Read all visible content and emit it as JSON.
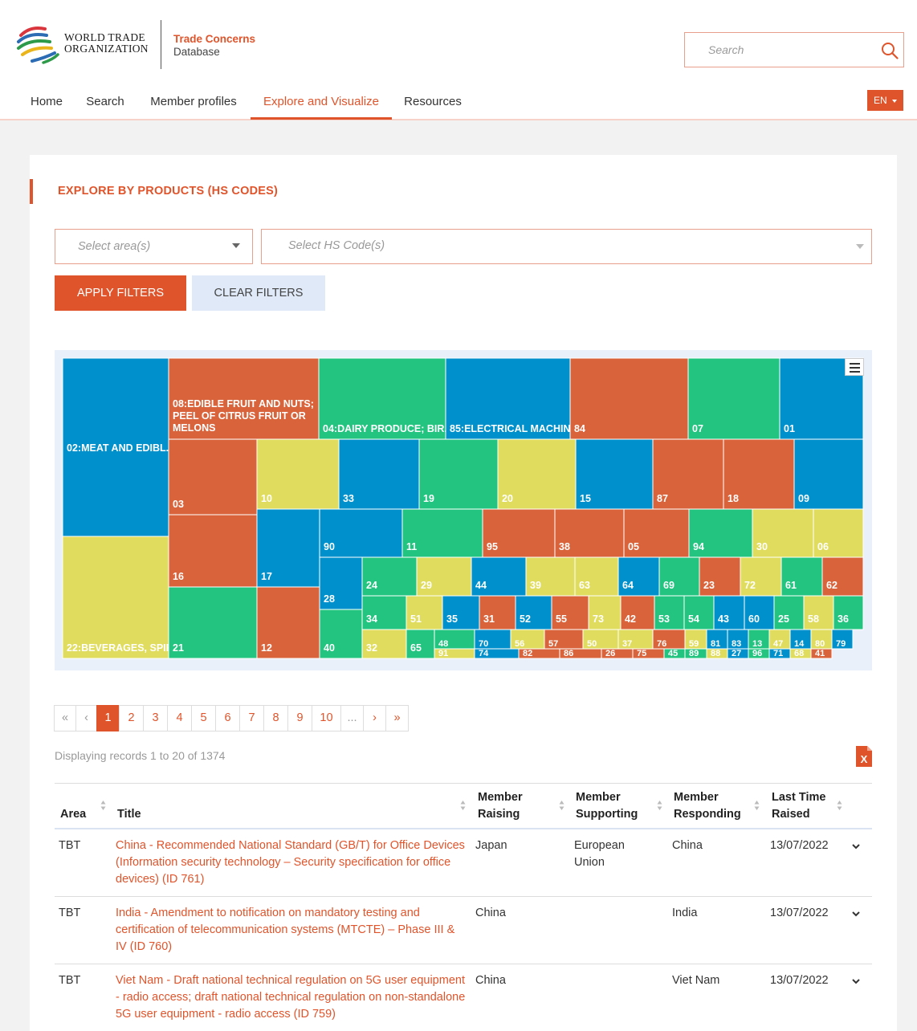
{
  "header": {
    "logo_line1": "WORLD TRADE",
    "logo_line2": "ORGANIZATION",
    "db_title": "Trade Concerns",
    "db_subtitle": "Database",
    "search_placeholder": "Search",
    "lang": "EN"
  },
  "nav": {
    "items": [
      {
        "label": "Home"
      },
      {
        "label": "Search"
      },
      {
        "label": "Member profiles"
      },
      {
        "label": "Explore and Visualize"
      },
      {
        "label": "Resources"
      }
    ],
    "active": "Explore and Visualize"
  },
  "section": {
    "title": "EXPLORE BY PRODUCTS (HS CODES)"
  },
  "filters": {
    "area_placeholder": "Select area(s)",
    "hs_placeholder": "Select HS Code(s)",
    "apply_label": "APPLY FILTERS",
    "clear_label": "CLEAR FILTERS"
  },
  "chart_data": {
    "type": "treemap",
    "colors": {
      "blue": "#0090cc",
      "red": "#d9643c",
      "green": "#23c47f",
      "yellow": "#e0dd5e"
    },
    "labeled_cells": [
      {
        "label": "02:MEAT AND EDIBL...",
        "color": "blue"
      },
      {
        "label": "22:BEVERAGES, SPIRI...",
        "color": "yellow"
      },
      {
        "label": "08:EDIBLE FRUIT AND NUTS; PEEL OF CITRUS FRUIT OR MELONS",
        "color": "red"
      },
      {
        "label": "04:DAIRY PRODUCE; BIR...",
        "color": "green"
      },
      {
        "label": "85:ELECTRICAL MACHIN...",
        "color": "blue"
      },
      {
        "label": "84",
        "color": "red"
      },
      {
        "label": "07",
        "color": "green"
      },
      {
        "label": "01",
        "color": "blue"
      },
      {
        "label": "03",
        "color": "red"
      },
      {
        "label": "10",
        "color": "yellow"
      },
      {
        "label": "33",
        "color": "blue"
      },
      {
        "label": "19",
        "color": "green"
      },
      {
        "label": "20",
        "color": "yellow"
      },
      {
        "label": "15",
        "color": "blue"
      },
      {
        "label": "87",
        "color": "red"
      },
      {
        "label": "18",
        "color": "red"
      },
      {
        "label": "09",
        "color": "blue"
      },
      {
        "label": "16",
        "color": "red"
      },
      {
        "label": "17",
        "color": "blue"
      },
      {
        "label": "90",
        "color": "blue"
      },
      {
        "label": "11",
        "color": "green"
      },
      {
        "label": "95",
        "color": "red"
      },
      {
        "label": "38",
        "color": "red"
      },
      {
        "label": "05",
        "color": "red"
      },
      {
        "label": "94",
        "color": "green"
      },
      {
        "label": "30",
        "color": "yellow"
      },
      {
        "label": "06",
        "color": "yellow"
      },
      {
        "label": "21",
        "color": "green"
      },
      {
        "label": "12",
        "color": "red"
      },
      {
        "label": "28",
        "color": "blue"
      },
      {
        "label": "40",
        "color": "green"
      },
      {
        "label": "24",
        "color": "green"
      },
      {
        "label": "29",
        "color": "yellow"
      },
      {
        "label": "44",
        "color": "blue"
      },
      {
        "label": "39",
        "color": "yellow"
      },
      {
        "label": "63",
        "color": "yellow"
      },
      {
        "label": "64",
        "color": "blue"
      },
      {
        "label": "69",
        "color": "green"
      },
      {
        "label": "23",
        "color": "red"
      },
      {
        "label": "72",
        "color": "yellow"
      },
      {
        "label": "61",
        "color": "green"
      },
      {
        "label": "62",
        "color": "red"
      },
      {
        "label": "34",
        "color": "green"
      },
      {
        "label": "51",
        "color": "yellow"
      },
      {
        "label": "35",
        "color": "blue"
      },
      {
        "label": "31",
        "color": "red"
      },
      {
        "label": "52",
        "color": "blue"
      },
      {
        "label": "55",
        "color": "red"
      },
      {
        "label": "73",
        "color": "yellow"
      },
      {
        "label": "42",
        "color": "red"
      },
      {
        "label": "53",
        "color": "green"
      },
      {
        "label": "54",
        "color": "green"
      },
      {
        "label": "43",
        "color": "blue"
      },
      {
        "label": "60",
        "color": "blue"
      },
      {
        "label": "25",
        "color": "green"
      },
      {
        "label": "58",
        "color": "yellow"
      },
      {
        "label": "36",
        "color": "green"
      },
      {
        "label": "32",
        "color": "yellow"
      },
      {
        "label": "65",
        "color": "green"
      },
      {
        "label": "48",
        "color": "green"
      },
      {
        "label": "91",
        "color": "yellow"
      },
      {
        "label": "70",
        "color": "blue"
      },
      {
        "label": "74",
        "color": "blue"
      },
      {
        "label": "56",
        "color": "yellow"
      },
      {
        "label": "82",
        "color": "red"
      },
      {
        "label": "57",
        "color": "red"
      },
      {
        "label": "86",
        "color": "red"
      },
      {
        "label": "50",
        "color": "yellow"
      },
      {
        "label": "26",
        "color": "red"
      },
      {
        "label": "37",
        "color": "yellow"
      },
      {
        "label": "75",
        "color": "red"
      },
      {
        "label": "76",
        "color": "red"
      },
      {
        "label": "45",
        "color": "green"
      },
      {
        "label": "59",
        "color": "yellow"
      },
      {
        "label": "89",
        "color": "green"
      },
      {
        "label": "81",
        "color": "blue"
      },
      {
        "label": "88",
        "color": "yellow"
      },
      {
        "label": "83",
        "color": "blue"
      },
      {
        "label": "27",
        "color": "blue"
      },
      {
        "label": "13",
        "color": "green"
      },
      {
        "label": "96",
        "color": "green"
      },
      {
        "label": "47",
        "color": "yellow"
      },
      {
        "label": "71",
        "color": "blue"
      },
      {
        "label": "14",
        "color": "blue"
      },
      {
        "label": "68",
        "color": "yellow"
      },
      {
        "label": "80",
        "color": "yellow"
      },
      {
        "label": "41",
        "color": "red"
      },
      {
        "label": "79",
        "color": "blue"
      }
    ]
  },
  "pagination": {
    "first": "«",
    "prev": "‹",
    "pages": [
      "1",
      "2",
      "3",
      "4",
      "5",
      "6",
      "7",
      "8",
      "9",
      "10"
    ],
    "ellipsis": "...",
    "next": "›",
    "last": "»",
    "current": "1"
  },
  "records_text": "Displaying records 1 to 20 of 1374",
  "table": {
    "headers": {
      "area": "Area",
      "title": "Title",
      "raising_1": "Member",
      "raising_2": "Raising",
      "supporting_1": "Member",
      "supporting_2": "Supporting",
      "responding_1": "Member",
      "responding_2": "Responding",
      "last_1": "Last Time",
      "last_2": "Raised"
    },
    "rows": [
      {
        "area": "TBT",
        "title": "China - Recommended National Standard (GB/T) for Office Devices (Information security technology – Security specification for office devices) (ID 761)",
        "raising": "Japan",
        "supporting": "European Union",
        "responding": "China",
        "date": "13/07/2022"
      },
      {
        "area": "TBT",
        "title": "India - Amendment to notification on mandatory testing and certification of telecommunication systems (MTCTE) – Phase III & IV (ID 760)",
        "raising": "China",
        "supporting": "",
        "responding": "India",
        "date": "13/07/2022"
      },
      {
        "area": "TBT",
        "title": "Viet Nam - Draft national technical regulation on 5G user equipment - radio access; draft national technical regulation on non-standalone 5G user equipment - radio access (ID 759)",
        "raising": "China",
        "supporting": "",
        "responding": "Viet Nam",
        "date": "13/07/2022"
      }
    ]
  }
}
